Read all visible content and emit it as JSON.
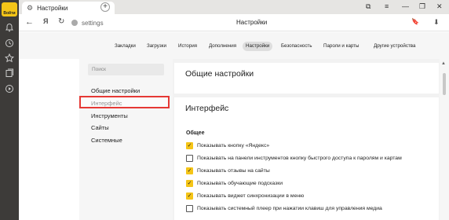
{
  "app": {
    "logo_text": "Войти"
  },
  "tab": {
    "title": "Настройки",
    "close": "✕"
  },
  "new_tab": "+",
  "window_controls": {
    "pin": "⧉",
    "menu": "≡",
    "minimize": "—",
    "maximize": "❐",
    "close": "✕"
  },
  "address": {
    "back": "←",
    "site_icon": "Я",
    "reload": "↻",
    "url": "settings",
    "page_title": "Настройки",
    "bookmark": "🔖",
    "download": "⬇"
  },
  "settings_nav": [
    "Закладки",
    "Загрузки",
    "История",
    "Дополнения",
    "Настройки",
    "Безопасность",
    "Пароли и карты",
    "Другие устройства"
  ],
  "sidebar": {
    "search_placeholder": "Поиск",
    "items": [
      "Общие настройки",
      "Интерфейс",
      "Инструменты",
      "Сайты",
      "Системные"
    ],
    "selected_index": 1
  },
  "main": {
    "general_title": "Общие настройки",
    "interface_title": "Интерфейс",
    "section_label": "Общее",
    "options": [
      {
        "label": "Показывать кнопку «Яндекс»",
        "checked": true
      },
      {
        "label": "Показывать на панели инструментов кнопку быстрого доступа к паролям и картам",
        "checked": false
      },
      {
        "label": "Показывать отзывы на сайты",
        "checked": true
      },
      {
        "label": "Показывать обучающие подсказки",
        "checked": true
      },
      {
        "label": "Показывать виджет синхронизации в меню",
        "checked": true
      },
      {
        "label": "Показывать системный плеер при нажатии клавиш для управления медиа",
        "checked": false
      }
    ]
  },
  "colors": {
    "accent": "#f5c518",
    "highlight_border": "#e53935",
    "sidebar": "#3d3b39"
  }
}
